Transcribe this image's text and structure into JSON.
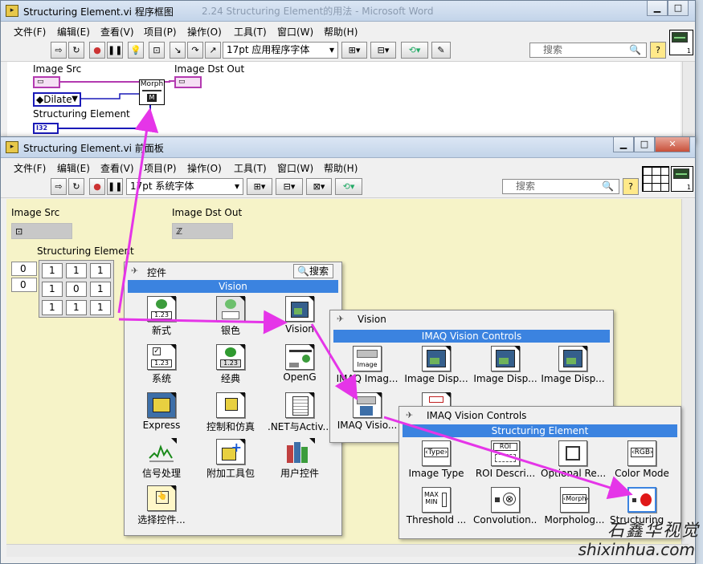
{
  "back_window": {
    "title": "Structuring Element.vi 程序框图",
    "behind_title": "2.24 Structuring Element的用法 - Microsoft Word",
    "menu": [
      "文件(F)",
      "编辑(E)",
      "查看(V)",
      "项目(P)",
      "操作(O)",
      "工具(T)",
      "窗口(W)",
      "帮助(H)"
    ],
    "font_select": "17pt 应用程序字体",
    "search_placeholder": "搜索",
    "labels": {
      "image_src": "Image Src",
      "image_dst_out": "Image Dst Out",
      "structuring_element": "Structuring Element",
      "morph_node": "Morph",
      "dilate": "Dilate",
      "i32": "I32"
    }
  },
  "front_window": {
    "title": "Structuring Element.vi 前面板",
    "menu": [
      "文件(F)",
      "编辑(E)",
      "查看(V)",
      "项目(P)",
      "操作(O)",
      "工具(T)",
      "窗口(W)",
      "帮助(H)"
    ],
    "font_select": "17pt 系统字体",
    "search_placeholder": "搜索",
    "labels": {
      "image_src": "Image Src",
      "image_dst_out": "Image Dst Out",
      "structuring_element": "Structuring Element"
    },
    "array_index": [
      "0",
      "0"
    ],
    "matrix": [
      [
        "1",
        "1",
        "1"
      ],
      [
        "1",
        "0",
        "1"
      ],
      [
        "1",
        "1",
        "1"
      ]
    ]
  },
  "palette_controls": {
    "title": "控件",
    "search_button": "搜索",
    "section": "Vision",
    "items": [
      "新式",
      "银色",
      "Vision",
      "系统",
      "经典",
      "OpenG",
      "Express",
      "控制和仿真",
      ".NET与Activ...",
      "信号处理",
      "附加工具包",
      "用户控件",
      "选择控件..."
    ]
  },
  "palette_vision": {
    "title": "Vision",
    "section": "IMAQ Vision Controls",
    "items": [
      "IMAQ Imag...",
      "Image Disp...",
      "Image Disp...",
      "Image Disp...",
      "IMAQ Visio..."
    ]
  },
  "palette_imaq": {
    "title": "IMAQ Vision Controls",
    "section": "Structuring Element",
    "items": [
      "Image Type",
      "ROI Descri...",
      "Optional Re...",
      "Color Mode",
      "Threshold ...",
      "Convolution...",
      "Morpholog...",
      "Structuring ..."
    ]
  },
  "watermark": {
    "cn": "石鑫华视觉",
    "url": "shixinhua.com"
  },
  "colors": {
    "accent_blue": "#3b83e0",
    "arrow_magenta": "#e535e8",
    "wire_pink": "#b33ab0",
    "wire_blue": "#1a1ab8",
    "panel_bg": "#f6f3c8"
  }
}
